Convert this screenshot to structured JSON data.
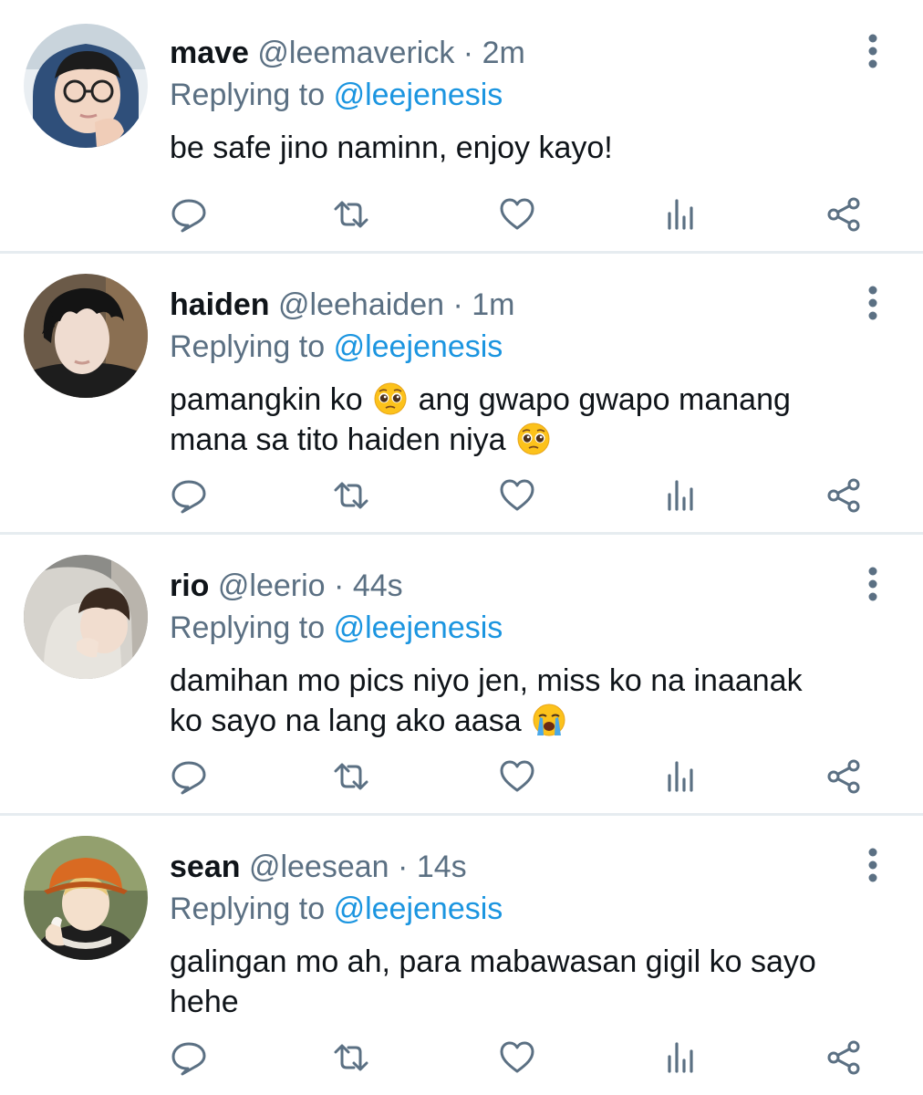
{
  "replies": [
    {
      "display_name": "mave",
      "handle": "@leemaverick",
      "separator": "·",
      "time": "2m",
      "replying_prefix": "Replying to",
      "replying_to": "@leejenesis",
      "text_parts": [
        "be safe jino naminn, enjoy kayo!"
      ],
      "avatar_icon": "avatar-glasses-person"
    },
    {
      "display_name": "haiden",
      "handle": "@leehaiden",
      "separator": "·",
      "time": "1m",
      "replying_prefix": "Replying to",
      "replying_to": "@leejenesis",
      "text_parts": [
        "pamangkin ko",
        "ang gwapo gwapo manang",
        "mana sa tito haiden niya"
      ],
      "emojis": [
        "pleading-face",
        "pleading-face"
      ],
      "avatar_icon": "avatar-dark-hair-person"
    },
    {
      "display_name": "rio",
      "handle": "@leerio",
      "separator": "·",
      "time": "44s",
      "replying_prefix": "Replying to",
      "replying_to": "@leejenesis",
      "text_parts": [
        "damihan mo pics niyo jen, miss ko na inaanak",
        "ko sayo na lang ako aasa"
      ],
      "emojis": [
        "loudly-crying-face"
      ],
      "avatar_icon": "avatar-hooded-person"
    },
    {
      "display_name": "sean",
      "handle": "@leesean",
      "separator": "·",
      "time": "14s",
      "replying_prefix": "Replying to",
      "replying_to": "@leejenesis",
      "text_parts": [
        "galingan mo ah, para mabawasan gigil ko sayo",
        "hehe"
      ],
      "avatar_icon": "avatar-orange-hat-person"
    }
  ],
  "action_icons": [
    "reply-icon",
    "retweet-icon",
    "like-icon",
    "analytics-icon",
    "share-icon"
  ],
  "colors": {
    "text_primary": "#0f1419",
    "text_secondary": "#5b7083",
    "mention": "#1b95e0",
    "divider": "#e6ecf0",
    "icon": "#5b7083"
  }
}
